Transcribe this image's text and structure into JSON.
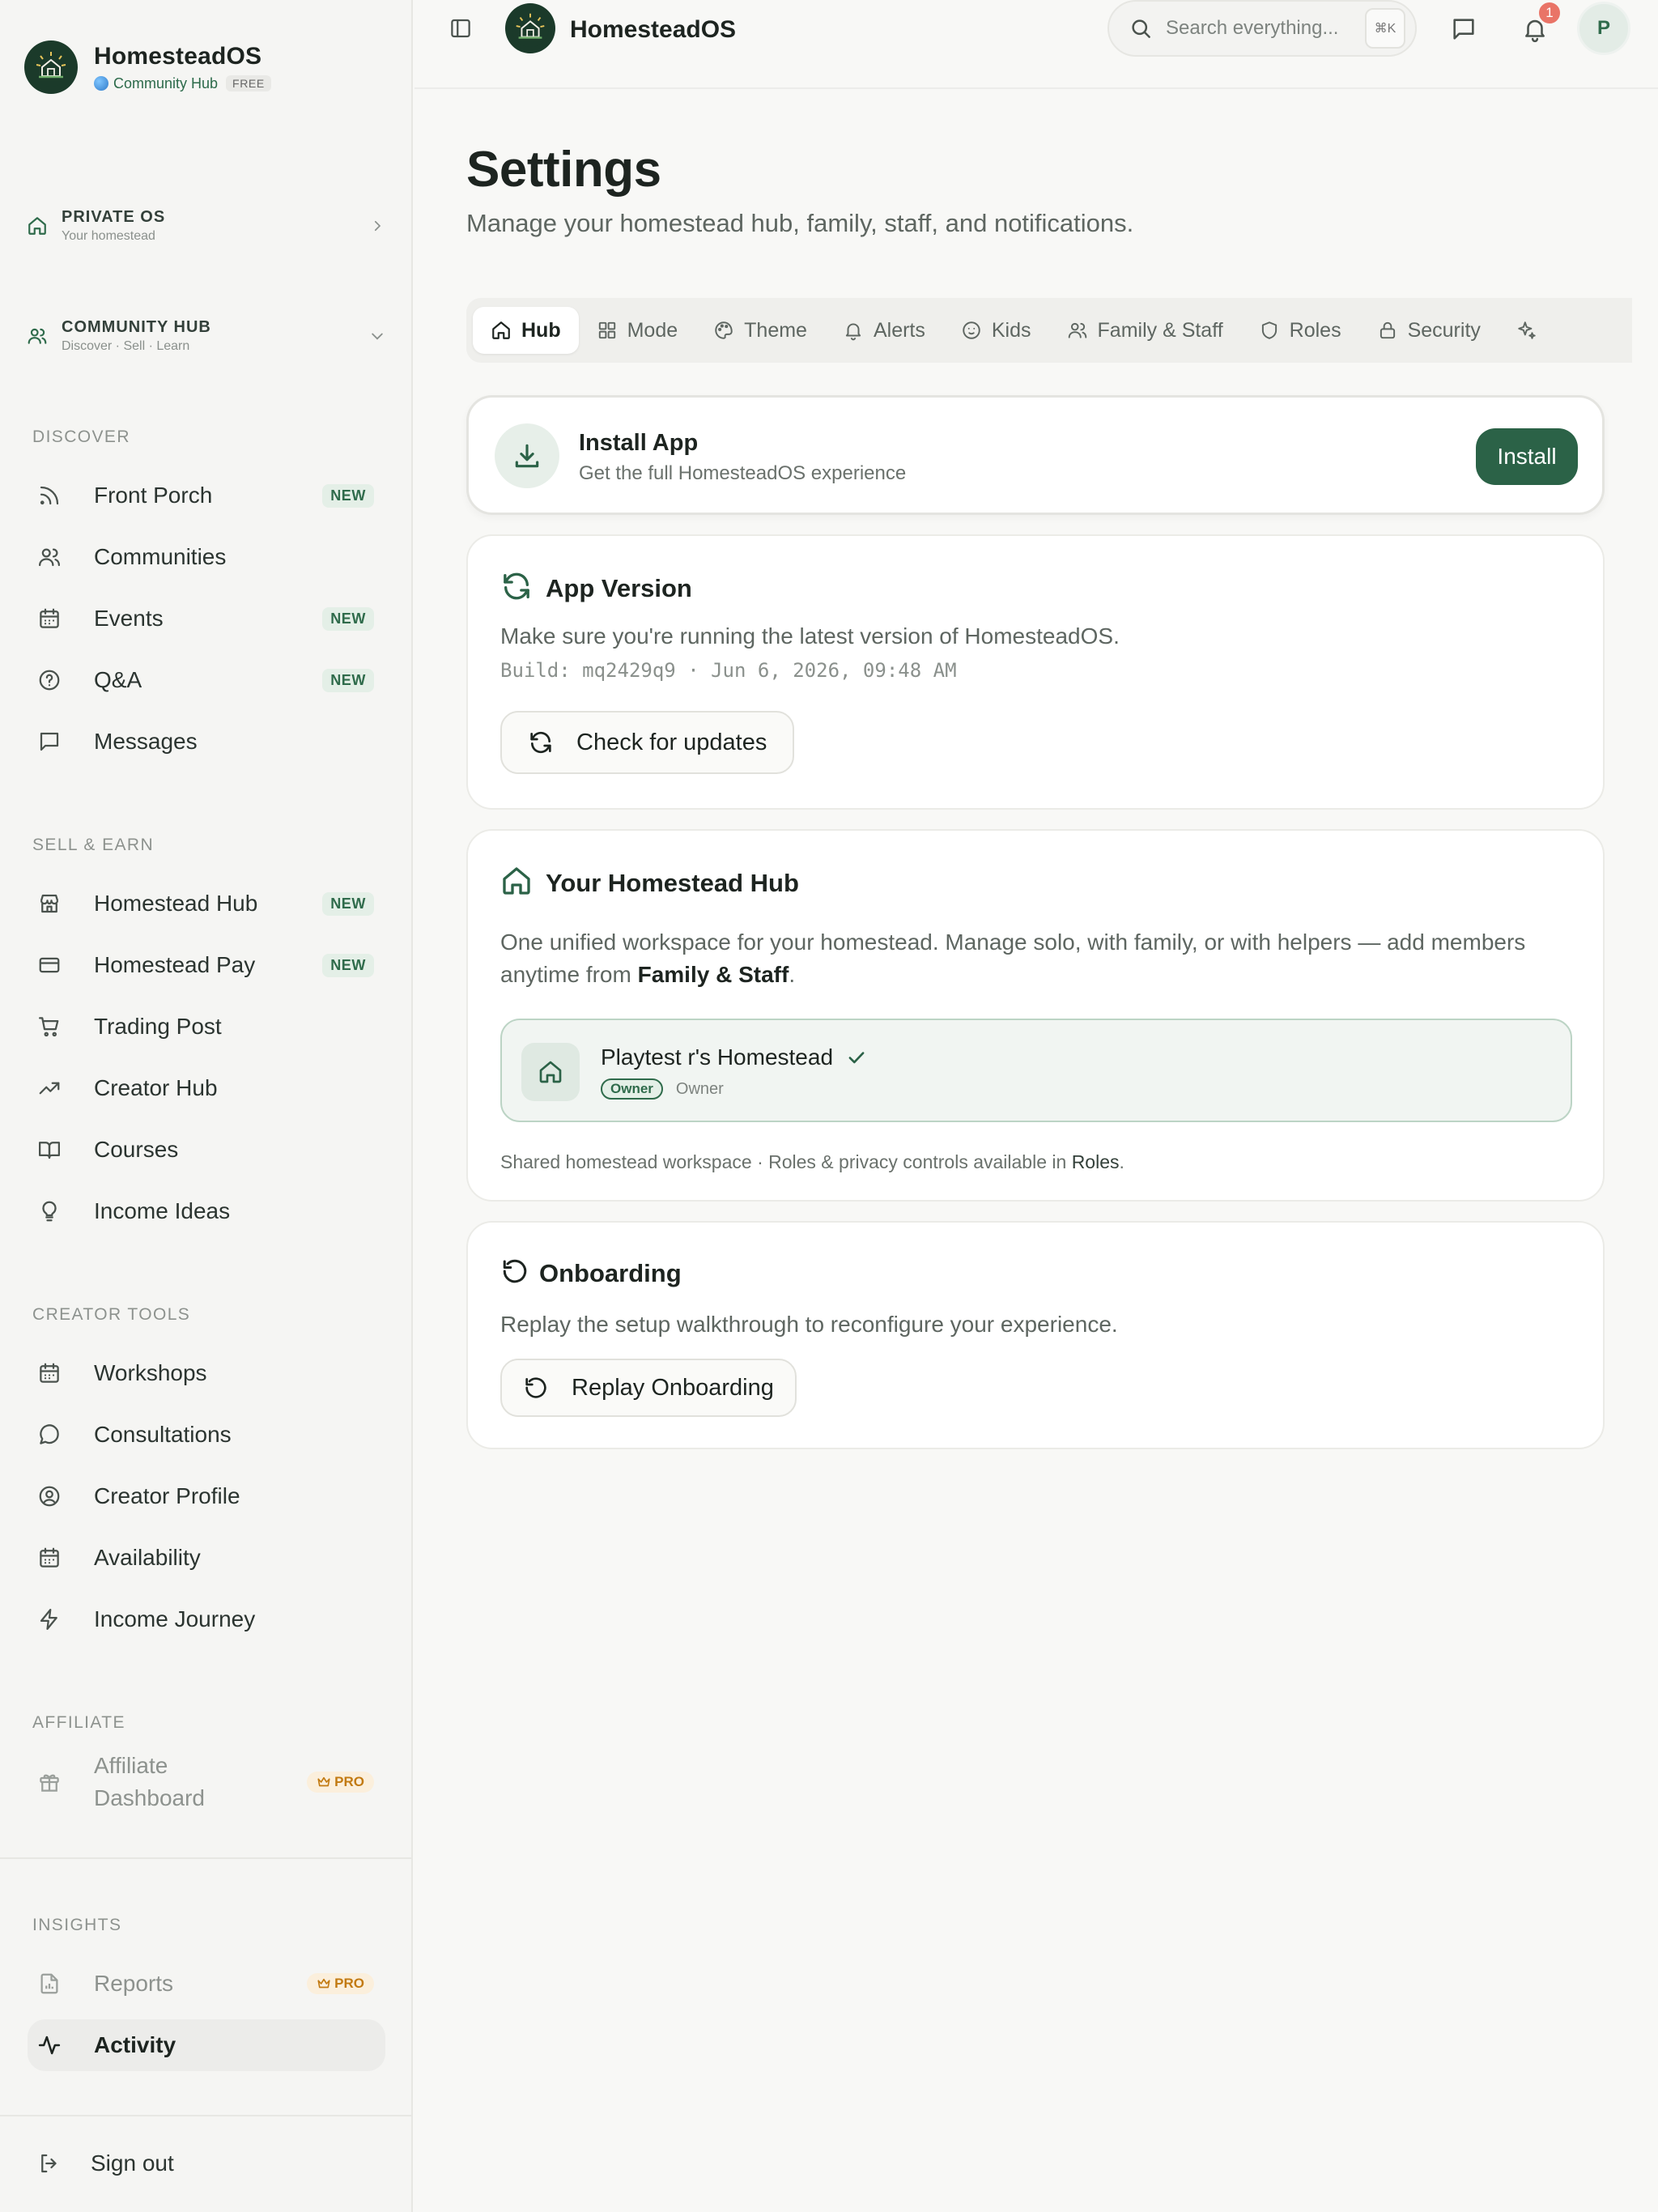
{
  "brand": {
    "name": "HomesteadOS",
    "sub": "Community Hub",
    "plan": "FREE"
  },
  "sections": {
    "private": {
      "title": "PRIVATE OS",
      "sub": "Your homestead"
    },
    "community": {
      "title": "COMMUNITY HUB",
      "sub": "Discover · Sell · Learn"
    }
  },
  "groups": {
    "discover": "DISCOVER",
    "sell": "SELL & EARN",
    "creator": "CREATOR TOOLS",
    "affiliate": "AFFILIATE",
    "insights": "INSIGHTS"
  },
  "nav": {
    "front_porch": "Front Porch",
    "communities": "Communities",
    "events": "Events",
    "qa": "Q&A",
    "messages": "Messages",
    "homestead_hub": "Homestead Hub",
    "homestead_pay": "Homestead Pay",
    "trading_post": "Trading Post",
    "creator_hub": "Creator Hub",
    "courses": "Courses",
    "income_ideas": "Income Ideas",
    "workshops": "Workshops",
    "consultations": "Consultations",
    "creator_profile": "Creator Profile",
    "availability": "Availability",
    "income_journey": "Income Journey",
    "affiliate_dashboard": "Affiliate Dashboard",
    "reports": "Reports",
    "activity": "Activity",
    "sign_out": "Sign out"
  },
  "badges": {
    "new": "NEW",
    "pro": "PRO"
  },
  "topbar": {
    "title": "HomesteadOS",
    "search_placeholder": "Search everything...",
    "shortcut": "⌘K",
    "notification_count": "1",
    "avatar_initial": "P"
  },
  "page": {
    "title": "Settings",
    "subtitle": "Manage your homestead hub, family, staff, and notifications."
  },
  "tabs": [
    "Hub",
    "Mode",
    "Theme",
    "Alerts",
    "Kids",
    "Family & Staff",
    "Roles",
    "Security"
  ],
  "install": {
    "title": "Install App",
    "subtitle": "Get the full HomesteadOS experience",
    "button": "Install"
  },
  "version": {
    "title": "App Version",
    "text": "Make sure you're running the latest version of HomesteadOS.",
    "build": "Build: mq2429q9 · Jun 6, 2026, 09:48 AM",
    "button": "Check for updates"
  },
  "hub": {
    "title": "Your Homestead Hub",
    "text_before": "One unified workspace for your homestead. Manage solo, with family, or with helpers — add members anytime from ",
    "text_link": "Family & Staff",
    "text_after": ".",
    "name": "Playtest r's Homestead",
    "role_badge": "Owner",
    "role": "Owner",
    "foot_before": "Shared homestead workspace · Roles & privacy controls available in ",
    "foot_link": "Roles",
    "foot_after": "."
  },
  "onboarding": {
    "title": "Onboarding",
    "text": "Replay the setup walkthrough to reconfigure your experience.",
    "button": "Replay Onboarding"
  },
  "colors": {
    "accent": "#2b6247",
    "badge_new_bg": "#e4efe7",
    "badge_pro_bg": "#fbefdc",
    "notification": "#e97467"
  }
}
